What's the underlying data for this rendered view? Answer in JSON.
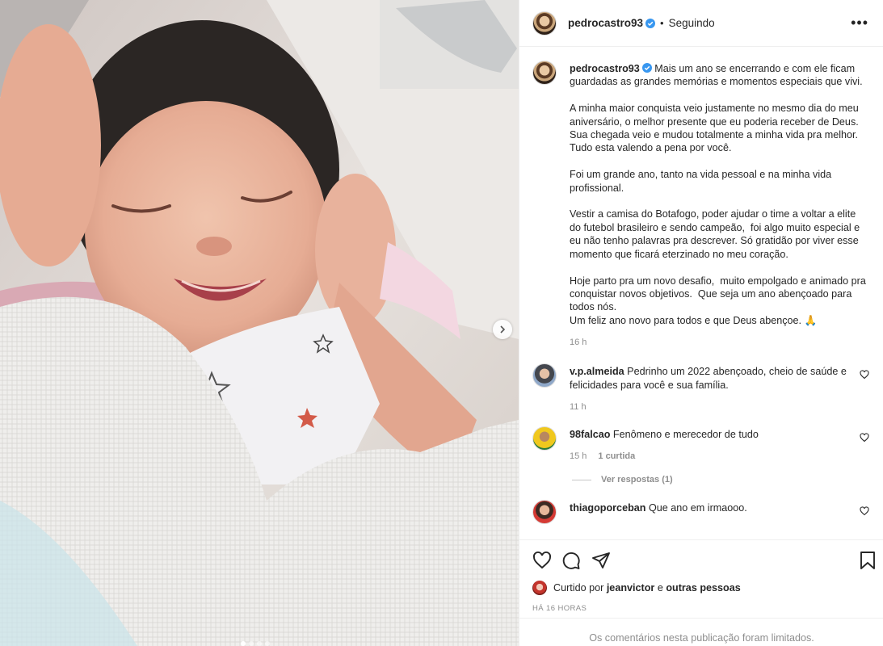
{
  "post": {
    "author": "pedrocastro93",
    "follow_status": "Seguindo",
    "separator": "•",
    "more_icon": "more-horizontal-icon",
    "caption": "Mais um ano se encerrando e com ele ficam guardadas as grandes memórias e momentos especiais que vivi.\n\nA minha maior conquista veio justamente no mesmo dia do meu aniversário, o melhor presente que eu poderia receber de Deus. Sua chegada veio e mudou totalmente a minha vida pra melhor. Tudo esta valendo a pena por você.\n\nFoi um grande ano, tanto na vida pessoal e na minha vida profissional.\n\nVestir a camisa do Botafogo, poder ajudar o time a voltar a elite do futebol brasileiro e sendo campeão,  foi algo muito especial e eu não tenho palavras pra descrever. Só gratidão por viver esse momento que ficará eterzinado no meu coração.\n\nHoje parto pra um novo desafio,  muito empolgado e animado pra conquistar novos objetivos.  Que seja um ano abençoado para todos nós.\nUm feliz ano novo para todos e que Deus abençoe. 🙏",
    "caption_time": "16 h"
  },
  "comments": [
    {
      "user": "v.p.almeida",
      "text": "Pedrinho um 2022 abençoado, cheio de saúde e felicidades para você e sua família.",
      "time": "11 h",
      "likes": ""
    },
    {
      "user": "98falcao",
      "text": "Fenômeno e merecedor de tudo",
      "time": "15 h",
      "likes": "1 curtida",
      "view_replies": "Ver respostas (1)"
    },
    {
      "user": "thiagoporceban",
      "text": "Que ano em irmaooo.",
      "time": "",
      "likes": ""
    }
  ],
  "likes_line": {
    "prefix": "Curtido por",
    "user": "jeanvictor",
    "conj": "e",
    "others": "outras pessoas"
  },
  "timestamp": "HÁ 16 HORAS",
  "comments_limited": "Os comentários nesta publicação foram limitados.",
  "icons": {
    "like": "heart-icon",
    "comment": "comment-icon",
    "share": "share-icon",
    "save": "bookmark-icon",
    "next": "chevron-right-icon",
    "verified": "verified-badge-icon"
  },
  "colors": {
    "verified": "#3897f0",
    "secondary_text": "#8e8e8e"
  }
}
